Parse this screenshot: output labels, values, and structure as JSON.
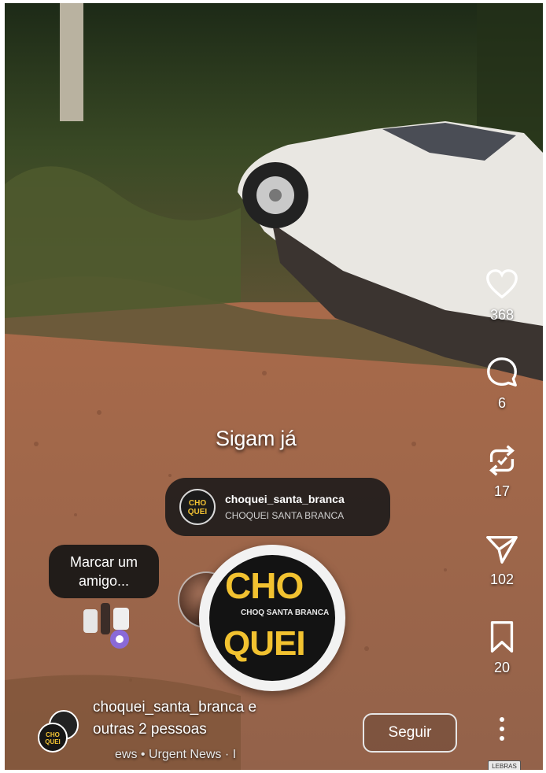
{
  "post": {
    "caption": "Sigam já",
    "mention": {
      "handle": "choquei_santa_branca",
      "display_name": "CHOQUEI SANTA BRANCA",
      "avatar_text": "CHO QUEI"
    },
    "tag_prompt": "Marcar um amigo...",
    "sticker": {
      "line1": "CHO",
      "line2": "QUEI",
      "small": "CHOQ SANTA BRANCA"
    }
  },
  "actions": {
    "likes": "368",
    "comments": "6",
    "reposts": "17",
    "shares": "102",
    "saves": "20"
  },
  "author": {
    "name_line": "choquei_santa_branca e",
    "others_line": "outras 2 pessoas",
    "music_line": "ews • Urgent News · I",
    "avatar_text": "CHO QUEI",
    "follow_label": "Seguir"
  },
  "corner_badge": "LEBRAS",
  "colors": {
    "accent_yellow": "#f2c230",
    "heart_red": "#e0333f",
    "panel_dark": "#191919"
  },
  "icons": [
    "heart-icon",
    "comment-icon",
    "repost-icon",
    "share-icon",
    "bookmark-icon",
    "more-icon"
  ]
}
